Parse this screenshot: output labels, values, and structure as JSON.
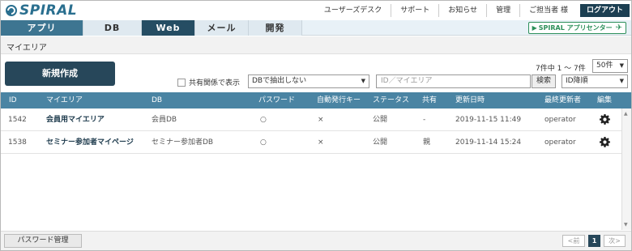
{
  "header": {
    "logo_text": "SPIRAL",
    "links": [
      "ユーザーズデスク",
      "サポート",
      "お知らせ",
      "管理",
      "ご担当者 様"
    ],
    "logout_label": "ログアウト"
  },
  "nav": {
    "tabs": [
      "アプリ",
      "DB",
      "Web",
      "メール",
      "開発"
    ],
    "active_tab": "Web",
    "app_center_label": "SPIRAL アプリセンター"
  },
  "breadcrumb": "マイエリア",
  "toolbar": {
    "new_button_label": "新規作成",
    "count_text": "7件中 1 ～ 7件",
    "per_page": "50件",
    "shared_checkbox_label": "共有関係で表示",
    "db_filter": "DBで抽出しない",
    "search_placeholder": "ID／マイエリア",
    "search_button": "検索",
    "sort": "ID降順"
  },
  "table": {
    "columns": [
      "ID",
      "マイエリア",
      "DB",
      "パスワード",
      "自動発行キー",
      "ステータス",
      "共有",
      "更新日時",
      "最終更新者",
      "編集"
    ],
    "rows": [
      {
        "id": "1542",
        "area": "会員用マイエリア",
        "db": "会員DB",
        "password": "○",
        "autokey": "×",
        "status": "公開",
        "shared": "-",
        "updated": "2019-11-15 11:49",
        "updater": "operator"
      },
      {
        "id": "1538",
        "area": "セミナー参加者マイページ",
        "db": "セミナー参加者DB",
        "password": "○",
        "autokey": "×",
        "status": "公開",
        "shared": "親",
        "updated": "2019-11-14 15:24",
        "updater": "operator"
      }
    ]
  },
  "footer": {
    "password_button": "パスワード管理",
    "prev": "<前",
    "page": "1",
    "next": "次>"
  },
  "colors": {
    "brand": "#2a6f8f",
    "dark": "#27475a",
    "table_header": "#4a84a3",
    "app_center": "#2c8f5a"
  },
  "icons": {
    "edit": "gear-icon",
    "app_center": "airplane-icon"
  }
}
